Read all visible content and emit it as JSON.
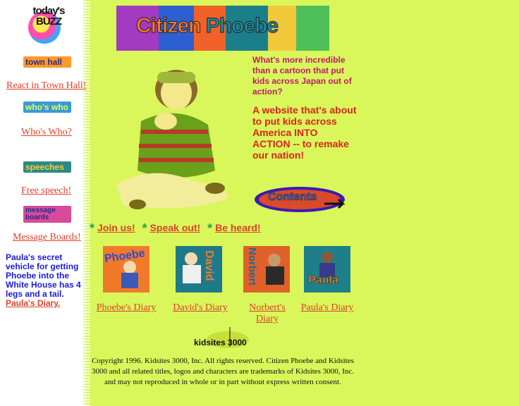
{
  "sidebar": {
    "buzz_logo": "today's BUZZ",
    "items": [
      {
        "icon_text": "town hall",
        "link": "React in Town Hall!"
      },
      {
        "icon_text": "who's who",
        "link": "Who's Who?"
      },
      {
        "icon_text": "speeches",
        "link": "Free speech!"
      },
      {
        "icon_text": "message boards",
        "link": "Message Boards!"
      }
    ],
    "promo": {
      "text": "Paula's secret vehicle for getting Phoebe into the White House has 4 legs and a tail.",
      "link": "Paula's Diary."
    }
  },
  "banner": {
    "word1": "Citizen",
    "word2": "Phoebe"
  },
  "headline1": "What's more incredible than a cartoon that put kids across Japan out of action?",
  "headline2": "A website that's about to put kids across America INTO ACTION -- to remake our nation!",
  "contents_button": "Contents",
  "cta": {
    "join": "Join us!",
    "speak": "Speak out!",
    "heard": "Be heard!"
  },
  "diaries": [
    {
      "name": "Phoebe",
      "link": "Phoebe's Diary"
    },
    {
      "name": "David",
      "link": "David's Diary"
    },
    {
      "name": "Norbert",
      "link": "Norbert's Diary"
    },
    {
      "name": "Paula",
      "link": "Paula's Diary"
    }
  ],
  "kidsites_logo": "kidsites 3000",
  "copyright": "Copyright 1996. Kidsites 3000, Inc. All rights reserved. Citizen Phoebe and Kidsites 3000 and all related titles, logos and characters are trademarks of Kidsites 3000, Inc. and may not reproduced in whole or in part without express written consent.",
  "colors": {
    "page_bg": "#d9f75a",
    "link": "#e0402a",
    "promo": "#1a1ad8",
    "headline1": "#c01a6a",
    "headline2": "#e22020",
    "star": "#2aa050"
  }
}
